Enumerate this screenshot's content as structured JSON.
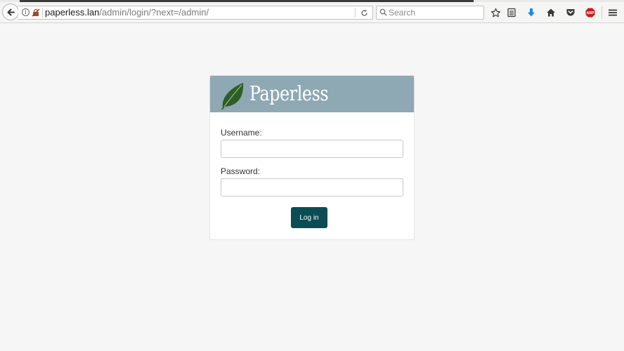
{
  "browser": {
    "url_host": "paperless.lan",
    "url_path": "/admin/login/?next=/admin/",
    "search_placeholder": "Search",
    "toolbar_icons": [
      "bookmark-star-icon",
      "reader-list-icon",
      "download-icon",
      "home-icon",
      "pocket-icon",
      "adblock-plus-icon",
      "hamburger-menu-icon"
    ],
    "adblock_label": "ABP",
    "colors": {
      "download": "#1e88e5",
      "adblock": "#c81e1e"
    }
  },
  "login": {
    "brand": "Paperless",
    "username_label": "Username:",
    "username_value": "",
    "password_label": "Password:",
    "password_value": "",
    "submit_label": "Log in",
    "colors": {
      "header": "#8ea8b4",
      "button": "#0c4c55",
      "leaf": "#2e5e22"
    }
  }
}
